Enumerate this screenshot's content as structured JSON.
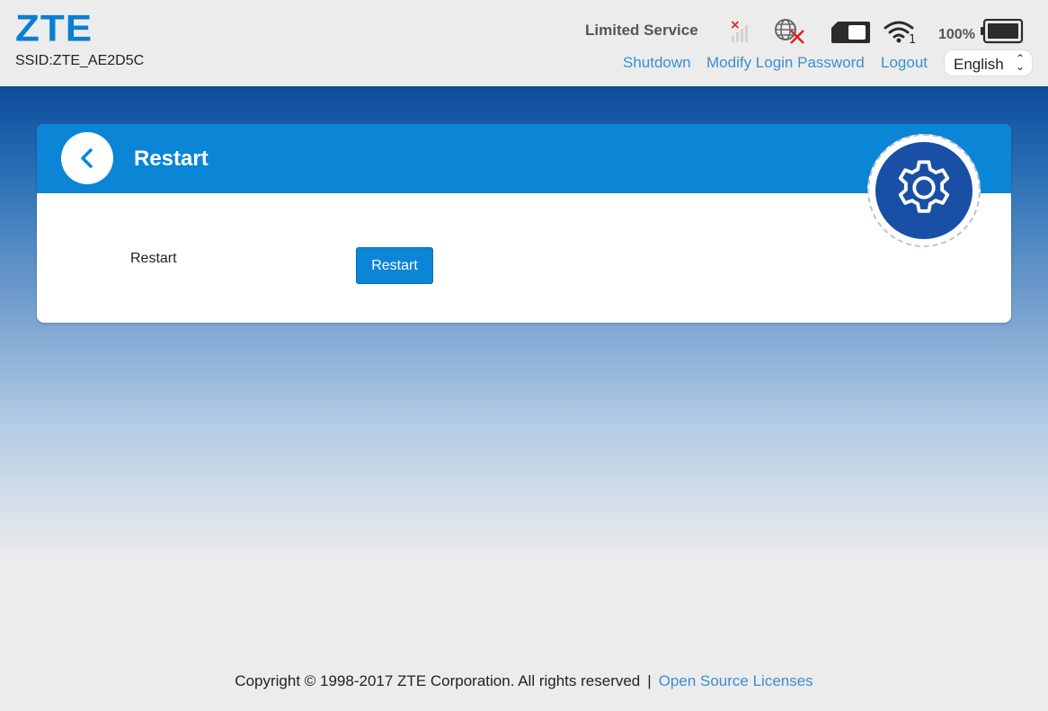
{
  "header": {
    "logo": "ZTE",
    "ssid": "SSID:ZTE_AE2D5C",
    "network_status": "Limited Service",
    "battery_percent": "100%",
    "wifi_clients": "1",
    "signal_alert": "×",
    "nav": {
      "shutdown": "Shutdown",
      "modify_password": "Modify Login Password",
      "logout": "Logout"
    },
    "language": "English"
  },
  "card": {
    "title": "Restart",
    "row_label": "Restart",
    "button_label": "Restart"
  },
  "footer": {
    "copyright": "Copyright © 1998-2017 ZTE Corporation. All rights reserved",
    "separator": "|",
    "licenses_link": "Open Source Licenses"
  },
  "icons": {
    "signal": "signal-strength-icon",
    "network": "globe-disconnected-icon",
    "sim": "sim-card-icon",
    "wifi": "wifi-icon",
    "battery": "battery-icon",
    "back": "chevron-left-icon",
    "settings": "gear-icon"
  },
  "colors": {
    "brand_blue": "#0b85d6",
    "link_blue": "#3a8fd3",
    "gear_circle": "#1a4fa6",
    "alert_red": "#e02020"
  }
}
